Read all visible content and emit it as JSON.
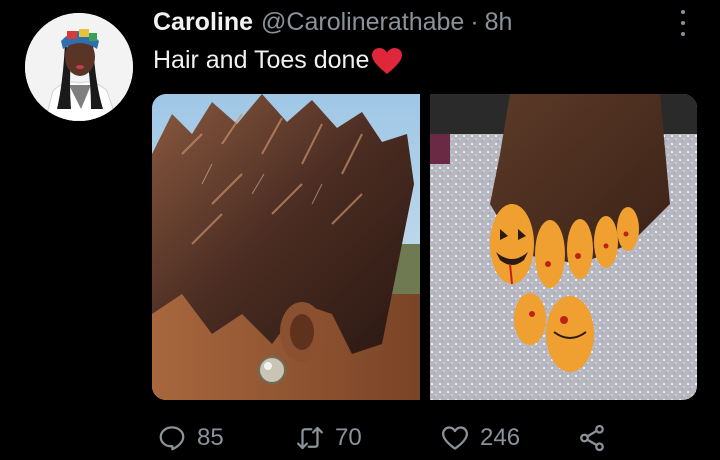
{
  "tweet": {
    "display_name": "Caroline",
    "handle": "@Carolinerathabe",
    "separator": "·",
    "time": "8h",
    "text": "Hair and Toes done",
    "emoji": "red-heart",
    "avatar": "user-avatar-photo",
    "media": [
      {
        "name": "hair-photo",
        "alt": "Close-up of short spiky brown-highlighted hair with a stud earring"
      },
      {
        "name": "toes-photo",
        "alt": "Toes with orange Halloween pumpkin nail art on a glittery background"
      }
    ]
  },
  "actions": {
    "reply_count": "85",
    "retweet_count": "70",
    "like_count": "246",
    "icons": [
      "reply-icon",
      "retweet-icon",
      "like-icon",
      "share-icon"
    ]
  },
  "colors": {
    "background": "#000000",
    "muted": "#8b9299",
    "text": "#e7e9ea",
    "heart": "#e0263a"
  }
}
